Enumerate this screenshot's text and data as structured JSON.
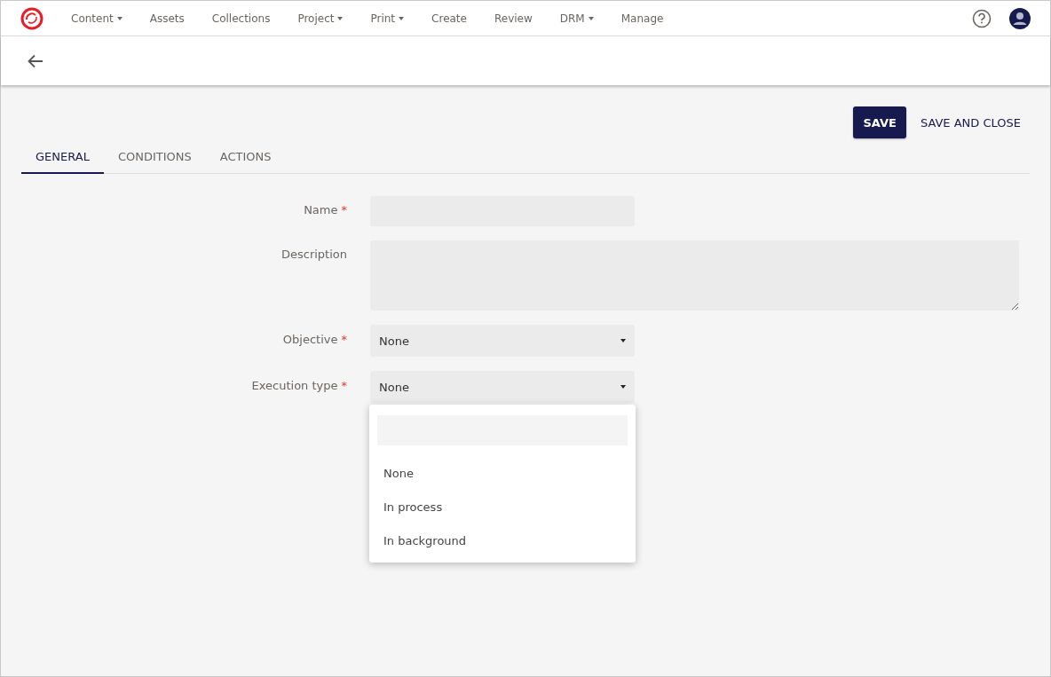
{
  "nav": {
    "items": [
      {
        "label": "Content",
        "has_menu": true
      },
      {
        "label": "Assets",
        "has_menu": false
      },
      {
        "label": "Collections",
        "has_menu": false
      },
      {
        "label": "Project",
        "has_menu": true
      },
      {
        "label": "Print",
        "has_menu": true
      },
      {
        "label": "Create",
        "has_menu": false
      },
      {
        "label": "Review",
        "has_menu": false
      },
      {
        "label": "DRM",
        "has_menu": true
      },
      {
        "label": "Manage",
        "has_menu": false
      }
    ]
  },
  "actions": [
    {
      "label": "SAVE",
      "kind": "primary"
    },
    {
      "label": "SAVE AND CLOSE",
      "kind": "text"
    }
  ],
  "tabs": [
    {
      "label": "GENERAL",
      "selected": true
    },
    {
      "label": "CONDITIONS",
      "selected": false
    },
    {
      "label": "ACTIONS",
      "selected": false
    }
  ],
  "form": [
    {
      "label": "Name",
      "required_mark": "*",
      "kind": "text"
    },
    {
      "label": "Description",
      "kind": "textarea"
    },
    {
      "label": "Objective",
      "required_mark": "*",
      "kind": "select",
      "value": "None",
      "expanded": false
    },
    {
      "label": "Execution type",
      "required_mark": "*",
      "kind": "select",
      "value": "None",
      "expanded": true,
      "options": [
        "None",
        "In process",
        "In background"
      ]
    }
  ]
}
